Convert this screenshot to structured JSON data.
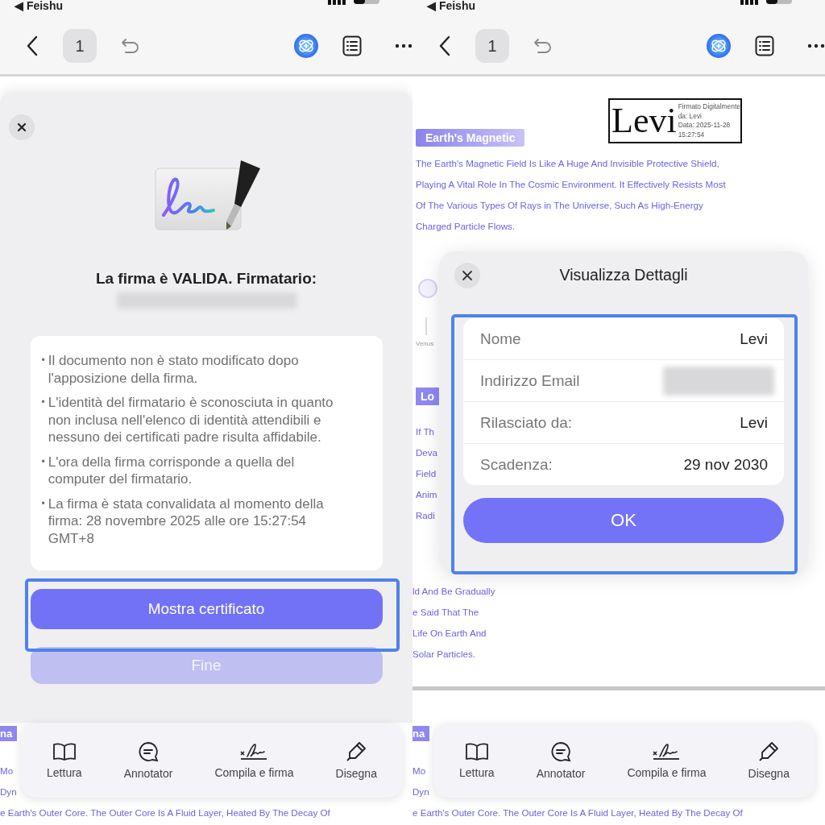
{
  "left_screen": {
    "status_bar": {
      "back_label": "◀ Feishu"
    },
    "toolbar": {
      "page": "1"
    },
    "document_peek": {
      "heading": "na",
      "lines": [
        "Mo",
        "Dyn",
        "e Earth's Outer Core. The Outer Core Is A Fluid Layer, Heated By The Decay Of"
      ]
    },
    "sheet": {
      "title": "La firma è VALIDA. Firmatario:",
      "bullet": "•",
      "notes": [
        "Il documento non è stato modificato dopo l'apposizione della firma.",
        "L'identità del firmatario è sconosciuta in quanto non inclusa nell'elenco di identità attendibili e nessuno dei certificati padre risulta affidabile.",
        "L'ora della firma corrisponde a quella del computer del firmatario.",
        "La firma è stata convalidata al momento della firma: 28 novembre 2025 alle ore 15:27:54 GMT+8"
      ],
      "buttons": [
        {
          "label": "Mostra certificato",
          "disabled": false
        },
        {
          "label": "Fine",
          "disabled": true
        }
      ]
    },
    "bottom_tabs": [
      {
        "label": "Lettura",
        "selected": false
      },
      {
        "label": "Annotator",
        "selected": false
      },
      {
        "label": "Compila e firma",
        "selected": false
      },
      {
        "label": "Disegna",
        "selected": false
      }
    ]
  },
  "right_screen": {
    "status_bar": {
      "back_label": "◀ Feishu"
    },
    "toolbar": {
      "page": "1"
    },
    "document": {
      "stamp": {
        "name": "Levi",
        "lines": [
          "Firmato Digitalmente",
          "da: Levi",
          "Data: 2025-11-28",
          "15:27:54"
        ]
      },
      "heading": "Earth's Magnetic",
      "paragraph": [
        "The Earth's Magnetic Field Is Like A Huge And Invisible Protective Shield,",
        "Playing A Vital Role In The Cosmic Environment. It Effectively Resists Most",
        "Of The Various Types Of Rays in The Universe, Such As High-Energy",
        "Charged Particle Flows."
      ],
      "side_label": "Venus",
      "heading_2": "Lo",
      "side_lines": [
        "If Th",
        "Deva",
        "Field",
        "Anim",
        "Radi"
      ],
      "cut_lines": [
        "ld And Be Gradually",
        "e Said That The",
        "Life On Earth And",
        "Solar Particles."
      ]
    },
    "document_peek": {
      "heading": "na",
      "lines": [
        "Mo",
        "Dyn",
        "e Earth's Outer Core. The Outer Core Is A Fluid Layer, Heated By The Decay Of"
      ]
    },
    "dialog": {
      "title": "Visualizza Dettagli",
      "rows": [
        {
          "label": "Nome",
          "value": "Levi"
        },
        {
          "label": "Indirizzo Email"
        },
        {
          "label": "Rilasciato da:",
          "value": "Levi"
        },
        {
          "label": "Scadenza:",
          "value": "29 nov 2030"
        }
      ],
      "button": "OK"
    },
    "bottom_tabs": [
      {
        "label": "Lettura",
        "selected": false
      },
      {
        "label": "Annotator",
        "selected": false
      },
      {
        "label": "Compila e firma",
        "selected": false
      },
      {
        "label": "Disegna",
        "selected": false
      }
    ]
  }
}
